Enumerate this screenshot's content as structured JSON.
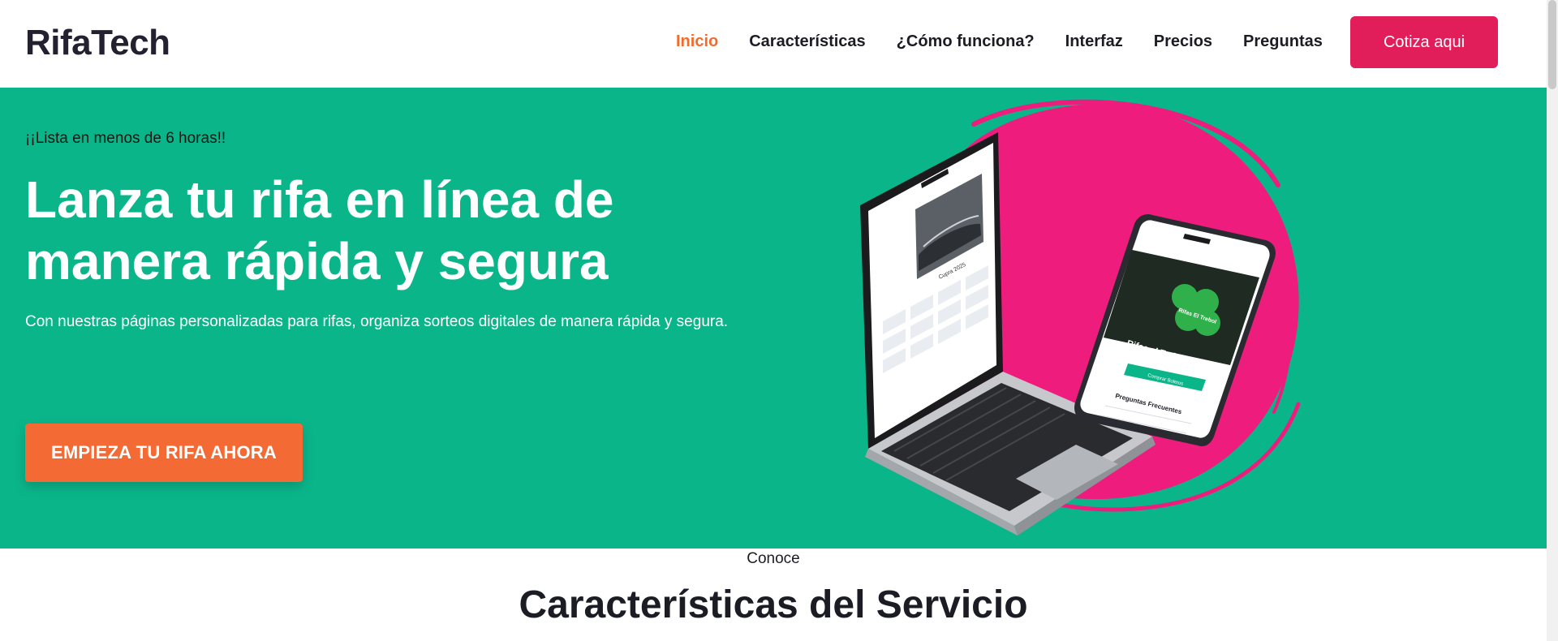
{
  "brand": {
    "name": "RifaTech"
  },
  "nav": {
    "items": [
      {
        "label": "Inicio",
        "active": true
      },
      {
        "label": "Características",
        "active": false
      },
      {
        "label": "¿Cómo funciona?",
        "active": false
      },
      {
        "label": "Interfaz",
        "active": false
      },
      {
        "label": "Precios",
        "active": false
      },
      {
        "label": "Preguntas",
        "active": false
      }
    ],
    "cta_label": "Cotiza aqui"
  },
  "hero": {
    "tagline": "¡¡Lista en menos de 6 horas!!",
    "title": "Lanza tu rifa en línea de manera rápida y segura",
    "description": "Con nuestras páginas personalizadas para rifas, organiza sorteos digitales de manera rápida y segura.",
    "button_label": "EMPIEZA TU RIFA AHORA",
    "mockup": {
      "phone_brand": "Rifas El Trebol",
      "phone_heading": "Rifas el Trebol",
      "phone_button": "Comprar Boletos",
      "phone_faq_title": "Preguntas Frecuentes",
      "laptop_caption": "Cupra 2025"
    }
  },
  "section": {
    "eyebrow": "Conoce",
    "title": "Características del Servicio"
  },
  "colors": {
    "hero_bg": "#0bb58a",
    "accent_orange": "#f46a34",
    "accent_pink": "#e11d5a",
    "nav_active": "#f36b2c",
    "splash_pink": "#ee1d7d"
  }
}
